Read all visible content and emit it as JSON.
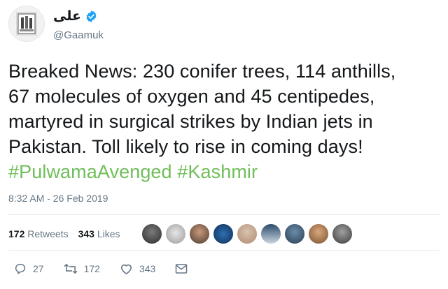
{
  "user": {
    "display_name": "علی",
    "handle": "@Gaamuk"
  },
  "tweet": {
    "body_line1": "Breaked News: 230 conifer trees, 114 anthills,",
    "body_line2": "67 molecules of oxygen and 45 centipedes,",
    "body_line3": "martyred in surgical strikes by Indian jets in",
    "body_line4": "Pakistan. Toll likely to rise in coming days!",
    "hashtag1": "#PulwamaAvenged",
    "hashtag2": "#Kashmir",
    "timestamp": "8:32 AM - 26 Feb 2019"
  },
  "stats": {
    "retweets_count": "172",
    "retweets_label": "Retweets",
    "likes_count": "343",
    "likes_label": "Likes"
  },
  "actions": {
    "reply_count": "27",
    "retweet_count": "172",
    "like_count": "343"
  },
  "colors": {
    "hashtag": "#6fbe5a",
    "verified": "#1da1f2",
    "secondary_text": "#657786"
  }
}
